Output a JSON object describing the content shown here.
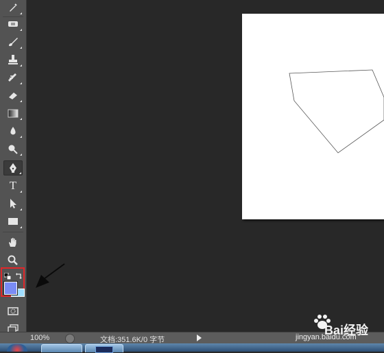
{
  "toolbar": {
    "tools": [
      {
        "name": "eyedropper"
      },
      {
        "name": "spot-healing"
      },
      {
        "name": "brush"
      },
      {
        "name": "clone-stamp"
      },
      {
        "name": "history-brush"
      },
      {
        "name": "eraser"
      },
      {
        "name": "gradient"
      },
      {
        "name": "blur"
      },
      {
        "name": "dodge"
      },
      {
        "name": "pen",
        "active": true
      },
      {
        "name": "type",
        "label": "T"
      },
      {
        "name": "path-selection"
      },
      {
        "name": "rectangle"
      },
      {
        "name": "hand"
      },
      {
        "name": "zoom"
      }
    ],
    "foreground_color": "#7a8cf5",
    "background_color": "#a0ddff",
    "highlight_color": "#e1272a"
  },
  "statusbar": {
    "zoom": "100%",
    "doc_info": "文档:351.6K/0 字节"
  },
  "watermark": {
    "logo_text": "Bai经验",
    "url": "jingyan.baidu.com"
  }
}
